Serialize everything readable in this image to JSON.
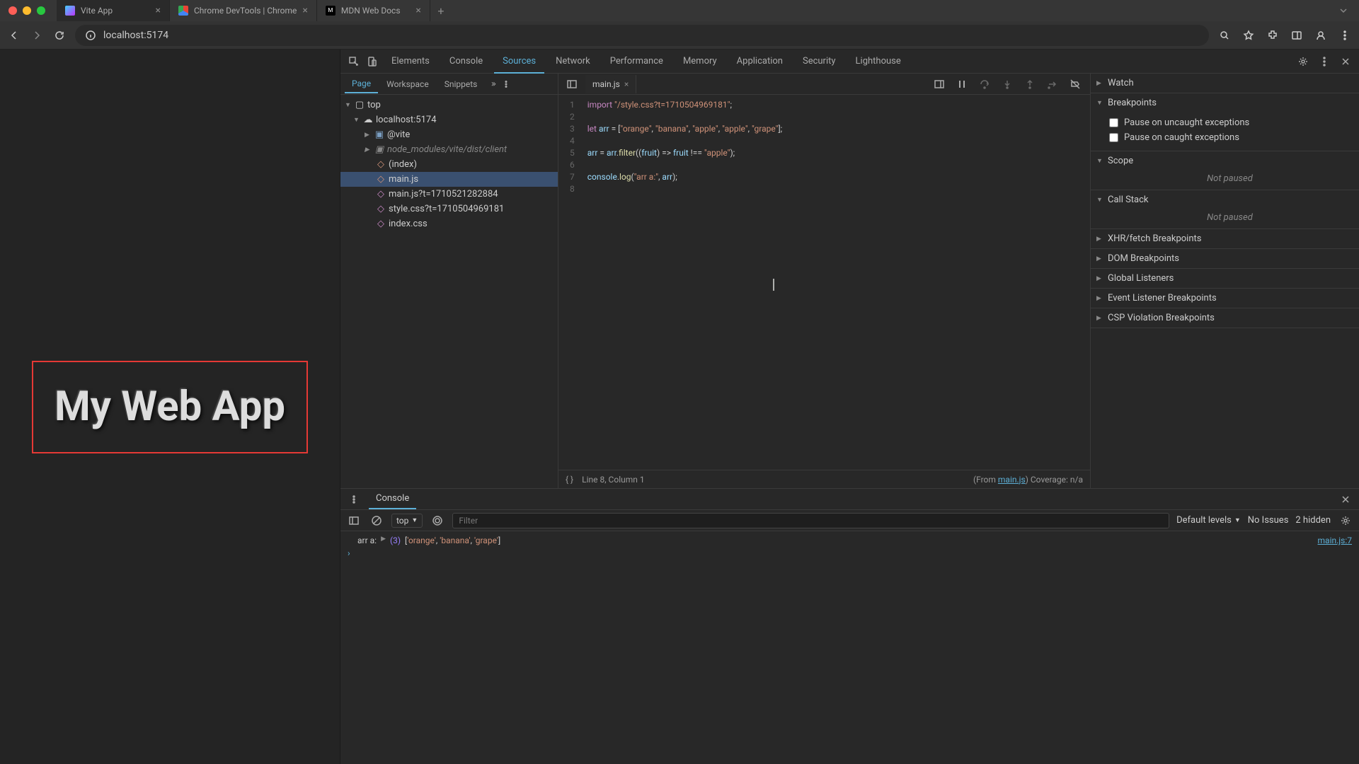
{
  "browser_tabs": [
    {
      "title": "Vite App",
      "active": true
    },
    {
      "title": "Chrome DevTools | Chrome",
      "active": false
    },
    {
      "title": "MDN Web Docs",
      "active": false
    }
  ],
  "url": "localhost:5174",
  "page_content": "My Web App",
  "devtools_tabs": [
    "Elements",
    "Console",
    "Sources",
    "Network",
    "Performance",
    "Memory",
    "Application",
    "Security",
    "Lighthouse"
  ],
  "devtools_active": "Sources",
  "nav_tabs": [
    "Page",
    "Workspace",
    "Snippets"
  ],
  "nav_active": "Page",
  "tree": {
    "top": "top",
    "host": "localhost:5174",
    "vite": "@vite",
    "nm": "node_modules/vite/dist/client",
    "files": [
      "(index)",
      "main.js",
      "main.js?t=1710521282884",
      "style.css?t=1710504969181",
      "index.css"
    ]
  },
  "editor_tab": "main.js",
  "code_lines": [
    "import \"/style.css?t=1710504969181\";",
    "",
    "let arr = [\"orange\", \"banana\", \"apple\", \"apple\", \"grape\"];",
    "",
    "arr = arr.filter((fruit) => fruit !== \"apple\");",
    "",
    "console.log(\"arr a:\", arr);",
    ""
  ],
  "cursor_pos": "Line 8, Column 1",
  "from_file": "main.js",
  "coverage": "Coverage: n/a",
  "debug": {
    "watch": "Watch",
    "breakpoints": "Breakpoints",
    "bp_uncaught": "Pause on uncaught exceptions",
    "bp_caught": "Pause on caught exceptions",
    "scope": "Scope",
    "not_paused": "Not paused",
    "callstack": "Call Stack",
    "xhr": "XHR/fetch Breakpoints",
    "dom": "DOM Breakpoints",
    "global": "Global Listeners",
    "event": "Event Listener Breakpoints",
    "csp": "CSP Violation Breakpoints"
  },
  "drawer": {
    "tab": "Console",
    "context": "top",
    "filter_placeholder": "Filter",
    "levels": "Default levels",
    "issues": "No Issues",
    "hidden": "2 hidden"
  },
  "log": {
    "label": "arr a:",
    "count": "(3)",
    "array": "['orange', 'banana', 'grape']",
    "source": "main.js:7"
  }
}
